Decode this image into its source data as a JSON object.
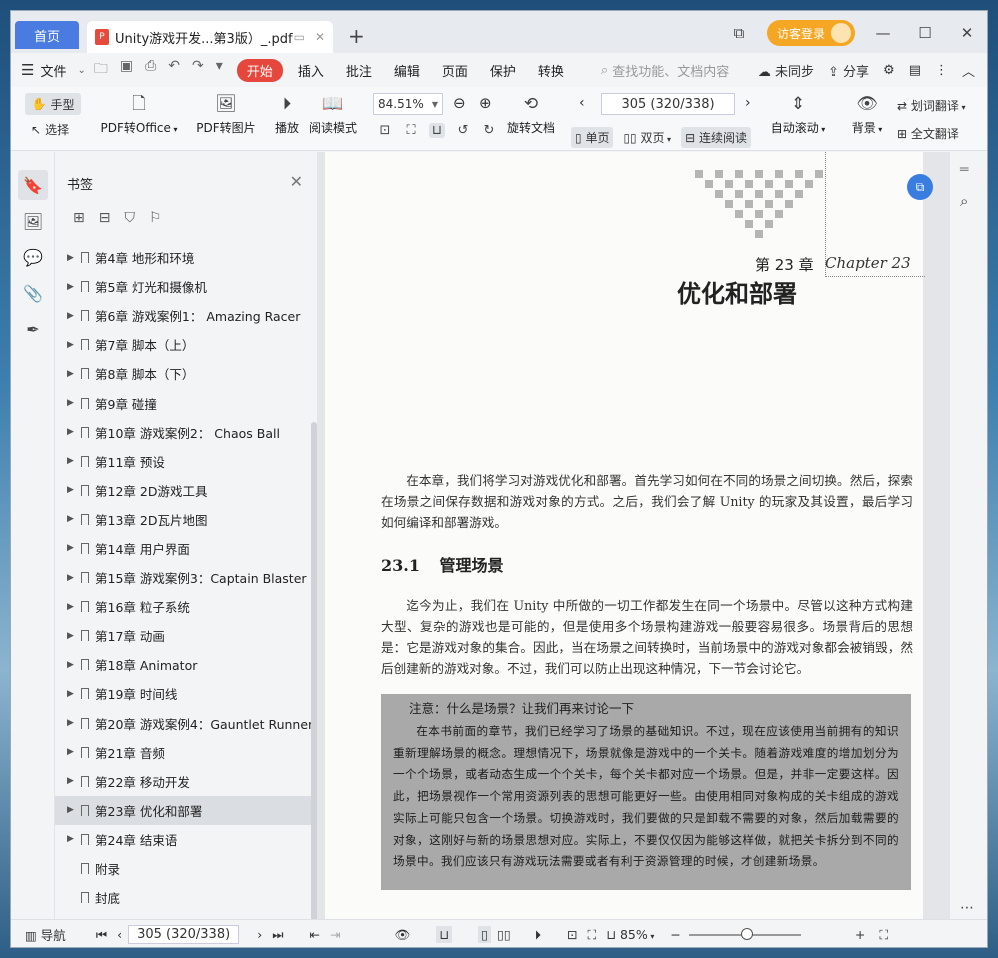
{
  "titlebar": {
    "home_tab": "首页",
    "doc_tab": "Unity游戏开发...第3版）_.pdf",
    "new_tab": "+",
    "visitor_login": "访客登录"
  },
  "menu": {
    "file": "文件",
    "start": "开始",
    "items": [
      "插入",
      "批注",
      "编辑",
      "页面",
      "保护",
      "转换"
    ],
    "search_placeholder": "查找功能、文档内容",
    "sync": "未同步",
    "share": "分享"
  },
  "ribbon": {
    "hand": "手型",
    "select": "选择",
    "pdf_to_office": "PDF转Office",
    "pdf_to_image": "PDF转图片",
    "play": "播放",
    "read_mode": "阅读模式",
    "zoom": "84.51%",
    "rotate": "旋转文档",
    "page": "305 (320/338)",
    "single": "单页",
    "double": "双页",
    "continuous": "连续阅读",
    "auto_scroll": "自动滚动",
    "background": "背景",
    "word_translate": "划词翻译",
    "full_translate": "全文翻译"
  },
  "bookmarks": {
    "title": "书签",
    "items": [
      {
        "label": "第4章 地形和环境",
        "arrow": true
      },
      {
        "label": "第5章 灯光和摄像机",
        "arrow": true
      },
      {
        "label": "第6章 游戏案例1： Amazing Racer",
        "arrow": true
      },
      {
        "label": "第7章 脚本（上）",
        "arrow": true
      },
      {
        "label": "第8章 脚本（下）",
        "arrow": true
      },
      {
        "label": "第9章 碰撞",
        "arrow": true
      },
      {
        "label": "第10章 游戏案例2： Chaos Ball",
        "arrow": true
      },
      {
        "label": "第11章 预设",
        "arrow": true
      },
      {
        "label": "第12章 2D游戏工具",
        "arrow": true
      },
      {
        "label": "第13章 2D瓦片地图",
        "arrow": true
      },
      {
        "label": "第14章 用户界面",
        "arrow": true
      },
      {
        "label": "第15章 游戏案例3：Captain Blaster",
        "arrow": true
      },
      {
        "label": "第16章 粒子系统",
        "arrow": true
      },
      {
        "label": "第17章 动画",
        "arrow": true
      },
      {
        "label": "第18章 Animator",
        "arrow": true
      },
      {
        "label": "第19章 时间线",
        "arrow": true
      },
      {
        "label": "第20章 游戏案例4：Gauntlet Runner",
        "arrow": true
      },
      {
        "label": "第21章 音频",
        "arrow": true
      },
      {
        "label": "第22章 移动开发",
        "arrow": true
      },
      {
        "label": "第23章 优化和部署",
        "arrow": true,
        "selected": true
      },
      {
        "label": "第24章 结束语",
        "arrow": true
      },
      {
        "label": "附录",
        "arrow": false
      },
      {
        "label": "封底",
        "arrow": false
      }
    ]
  },
  "document": {
    "chapter_number": "第 23 章",
    "chapter_script": "Chapter 23",
    "chapter_title": "优化和部署",
    "intro": "在本章，我们将学习对游戏优化和部署。首先学习如何在不同的场景之间切换。然后，探索在场景之间保存数据和游戏对象的方式。之后，我们会了解 Unity 的玩家及其设置，最后学习如何编译和部署游戏。",
    "section_number": "23.1",
    "section_title": "管理场景",
    "section_body": "迄今为止，我们在 Unity 中所做的一切工作都发生在同一个场景中。尽管以这种方式构建大型、复杂的游戏也是可能的，但是使用多个场景构建游戏一般要容易很多。场景背后的思想是：它是游戏对象的集合。因此，当在场景之间转换时，当前场景中的游戏对象都会被销毁，然后创建新的游戏对象。不过，我们可以防止出现这种情况，下一节会讨论它。",
    "note_title": "注意：什么是场景？让我们再来讨论一下",
    "note_body": "在本书前面的章节，我们已经学习了场景的基础知识。不过，现在应该使用当前拥有的知识重新理解场景的概念。理想情况下，场景就像是游戏中的一个关卡。随着游戏难度的增加划分为一个个场景，或者动态生成一个个关卡，每个关卡都对应一个场景。但是，并非一定要这样。因此，把场景视作一个常用资源列表的思想可能更好一些。由使用相同对象构成的关卡组成的游戏实际上可能只包含一个场景。切换游戏时，我们要做的只是卸载不需要的对象，然后加载需要的对象，这刚好与新的场景思想对应。实际上，不要仅仅因为能够这样做，就把关卡拆分到不同的场景中。我们应该只有游戏玩法需要或者有利于资源管理的时候，才创建新场景。"
  },
  "status": {
    "nav": "导航",
    "page": "305 (320/338)",
    "zoom": "85%"
  }
}
